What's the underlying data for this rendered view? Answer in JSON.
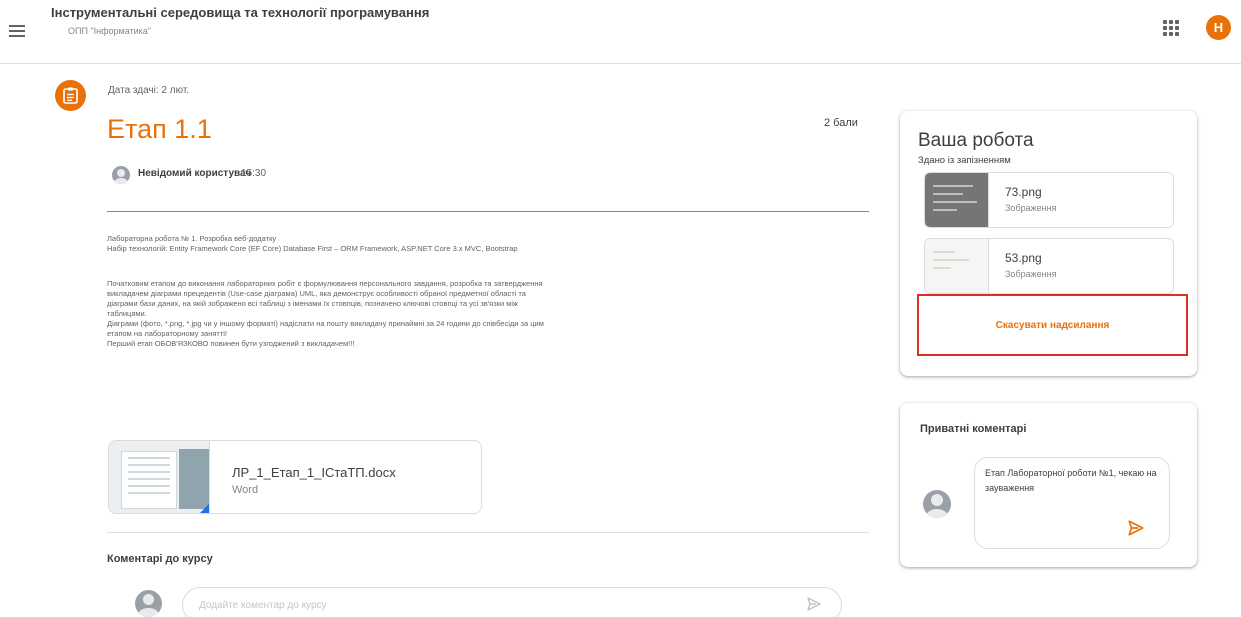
{
  "header": {
    "course_title": "Інструментальні середовища та технології програмування",
    "course_subtitle": "ОПП \"Інформатика\"",
    "user_initial": "Н",
    "accent_color": "#e8710a"
  },
  "assignment": {
    "due_date": "Дата здачі: 2 лют.",
    "title": "Етап 1.1",
    "points": "2 бали",
    "author": "Невідомий користувач",
    "time": "15:30",
    "description_lines_1": [
      "Лабораторна робота № 1. Розробка веб-додатку",
      "Набір технологій: Entity Framework Core (EF Core) Database First – ORM Framework, ASP.NET Core 3.x MVC, Bootstrap"
    ],
    "description_lines_2": [
      "Початковим етапом до виконання лабораторних робіт є формулювання персонального завдання, розробка та затвердження",
      "викладачем діаграми прецедентів (Use-case діаграма) UML, яка демонструє особливості обраної предметної області та",
      "діаграми бази даних, на якій зображено всі таблиці з іменами їх стовпців, позначено ключові стовпці та усі зв'язки між",
      "таблицями.",
      "Діаграми (фото, *.png, *.jpg чи у іншому форматі) надіслати на пошту викладачу принаймні за 24 години до співбесіди за цим",
      "етапом на лабораторному занятті!",
      "Перший етап ОБОВ'ЯЗКОВО повинен бути узгоджений з викладачем!!!"
    ],
    "attachment": {
      "name": "ЛР_1_Етап_1_ІСтаТП.docx",
      "type": "Word",
      "icon": "word-doc-icon"
    }
  },
  "class_comments": {
    "heading": "Коментарі до курсу",
    "placeholder": "Додайте коментар до курсу"
  },
  "your_work": {
    "title": "Ваша робота",
    "status": "Здано із запізненням",
    "files": [
      {
        "name": "73.png",
        "type": "Зображення"
      },
      {
        "name": "53.png",
        "type": "Зображення"
      }
    ],
    "unsubmit_label": "Скасувати надсилання",
    "highlight_color": "#d93025"
  },
  "private_comments": {
    "title": "Приватні коментарі",
    "text": "Етап Лабораторної роботи №1, чекаю на зауваження"
  }
}
